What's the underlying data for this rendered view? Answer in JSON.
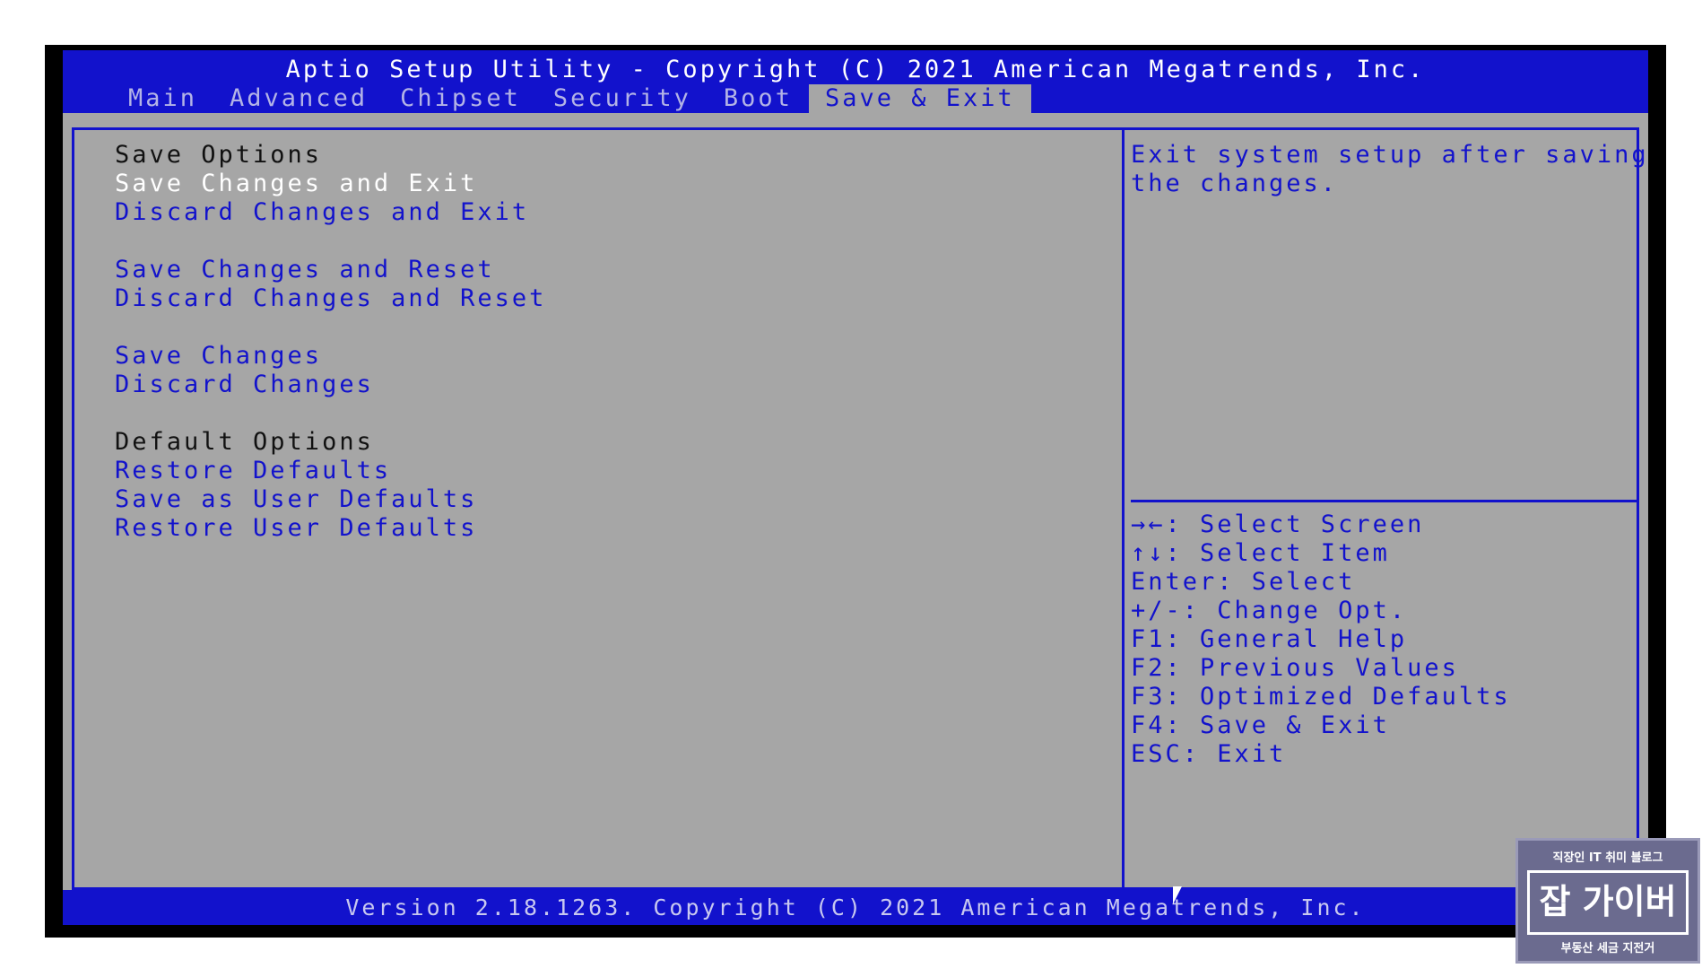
{
  "header": {
    "title": "Aptio Setup Utility - Copyright (C) 2021 American Megatrends, Inc."
  },
  "tabs": [
    {
      "label": "Main"
    },
    {
      "label": "Advanced"
    },
    {
      "label": "Chipset"
    },
    {
      "label": "Security"
    },
    {
      "label": "Boot"
    },
    {
      "label": "Save & Exit",
      "active": true
    }
  ],
  "menu": {
    "save_options_heading": "Save Options",
    "save_changes_and_exit": "Save Changes and Exit",
    "discard_changes_and_exit": "Discard Changes and Exit",
    "save_changes_and_reset": "Save Changes and Reset",
    "discard_changes_and_reset": "Discard Changes and Reset",
    "save_changes": "Save Changes",
    "discard_changes": "Discard Changes",
    "default_options_heading": "Default Options",
    "restore_defaults": "Restore Defaults",
    "save_as_user_defaults": "Save as User Defaults",
    "restore_user_defaults": "Restore User Defaults"
  },
  "help": {
    "line1": "Exit system setup after saving",
    "line2": "the changes."
  },
  "keys": [
    "→←: Select Screen",
    "↑↓: Select Item",
    "Enter: Select",
    "+/-: Change Opt.",
    "F1: General Help",
    "F2: Previous Values",
    "F3: Optimized Defaults",
    "F4: Save & Exit",
    "ESC: Exit"
  ],
  "footer": {
    "version": "Version 2.18.1263. Copyright (C) 2021 American Megatrends, Inc."
  },
  "watermark": {
    "top": "직장인 IT 취미 블로그",
    "mid": "잡 가이버",
    "bottom": "부동산 세금 지전거"
  },
  "colors": {
    "bios_blue": "#1212cc",
    "bios_gray": "#a6a6a6",
    "selected_text": "#ffffff"
  }
}
